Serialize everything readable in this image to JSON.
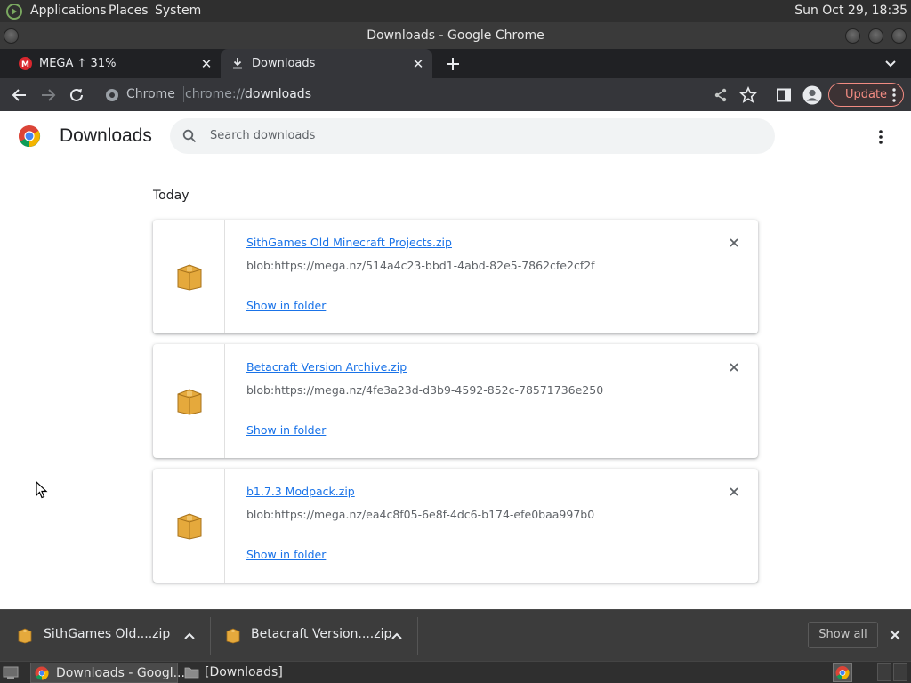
{
  "top_panel": {
    "menus": [
      "Applications",
      "Places",
      "System"
    ],
    "clock": "Sun Oct 29, 18:35"
  },
  "window": {
    "title": "Downloads - Google Chrome"
  },
  "tabs": [
    {
      "label": "MEGA ↑ 31%",
      "favicon": "mega-icon",
      "active": false
    },
    {
      "label": "Downloads",
      "favicon": "download-icon",
      "active": true
    }
  ],
  "toolbar": {
    "site_label": "Chrome",
    "url_scheme": "chrome://",
    "url_path": "downloads",
    "update_label": "Update"
  },
  "page": {
    "title": "Downloads",
    "search_placeholder": "Search downloads",
    "section": "Today",
    "items": [
      {
        "name": "SithGames Old Minecraft Projects.zip",
        "url": "blob:https://mega.nz/514a4c23-bbd1-4abd-82e5-7862cfe2cf2f",
        "action": "Show in folder"
      },
      {
        "name": "Betacraft Version Archive.zip",
        "url": "blob:https://mega.nz/4fe3a23d-d3b9-4592-852c-78571736e250",
        "action": "Show in folder"
      },
      {
        "name": "b1.7.3 Modpack.zip",
        "url": "blob:https://mega.nz/ea4c8f05-6e8f-4dc6-b174-efe0baa997b0",
        "action": "Show in folder"
      }
    ]
  },
  "shelf": {
    "items": [
      {
        "name": "SithGames Old....zip"
      },
      {
        "name": "Betacraft Version....zip"
      }
    ],
    "show_all_label": "Show all"
  },
  "taskbar": {
    "tasks": [
      {
        "label": "Downloads - Googl..."
      },
      {
        "label": "[Downloads]"
      }
    ]
  },
  "colors": {
    "accent_link": "#1a73e8",
    "update_outline": "#f28b82",
    "dark_toolbar": "#35363a",
    "tab_strip": "#202124"
  }
}
